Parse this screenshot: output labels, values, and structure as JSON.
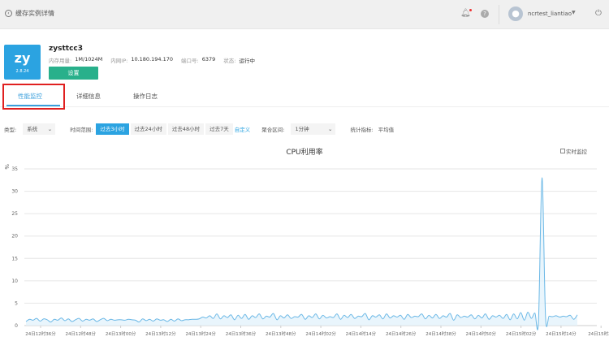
{
  "header": {
    "back_label": "缓存实例详情",
    "username": "ncrtest_liantiao",
    "icons": [
      "back-circle-icon",
      "bell-icon",
      "help-icon",
      "avatar-icon",
      "caret-down-icon",
      "power-icon"
    ]
  },
  "instance": {
    "logo_text": "zy",
    "version": "2.8.24",
    "name": "zysttcc3",
    "memory_label": "内存用量:",
    "memory_value": "1M/1024M",
    "ip_label": "内网IP:",
    "ip_value": "10.180.194.170",
    "port_label": "端口号:",
    "port_value": "6379",
    "status_label": "状态:",
    "status_value": "运行中",
    "settings_button": "设置"
  },
  "tabs": [
    {
      "label": "性能监控",
      "active": true
    },
    {
      "label": "详细信息"
    },
    {
      "label": "操作日志"
    }
  ],
  "filters": {
    "type_label": "类型:",
    "type_value": "系统",
    "range_label": "时间范围:",
    "ranges": [
      "过去3小时",
      "过去24小时",
      "过去48小时",
      "过去7天"
    ],
    "active_range": "过去3小时",
    "custom_link": "自定义",
    "agg_label": "聚合区间:",
    "agg_value": "1分钟",
    "stat_label": "统计指标:",
    "stat_value": "平均值"
  },
  "realtime_label": "实时监控",
  "colors": {
    "accent": "#2ba3e1",
    "button": "#28b08b",
    "line": "#6bb8e6",
    "highlight": "#e02020"
  },
  "chart_data": {
    "type": "area",
    "title": "CPU利用率",
    "ylabel": "%",
    "ylim": [
      0,
      35
    ],
    "yticks": [
      0,
      5,
      10,
      15,
      20,
      25,
      30,
      35
    ],
    "grid": true,
    "xticks": [
      "24日12时36分",
      "24日12时48分",
      "24日13时00分",
      "24日13时12分",
      "24日13时24分",
      "24日13时36分",
      "24日13时48分",
      "24日14时02分",
      "24日14时14分",
      "24日14时26分",
      "24日14时38分",
      "24日14时50分",
      "24日15时02分",
      "24日15时14分",
      "24日15时26"
    ],
    "values": [
      0.9,
      1.4,
      1.2,
      1.6,
      1.0,
      1.5,
      1.3,
      0.8,
      1.4,
      1.2,
      1.7,
      1.1,
      1.5,
      0.9,
      1.3,
      1.6,
      1.0,
      1.4,
      1.2,
      1.5,
      0.9,
      1.3,
      1.6,
      1.1,
      1.4,
      1.2,
      1.3,
      1.3,
      1.2,
      1.4,
      1.3,
      1.2,
      0.8,
      1.5,
      1.1,
      1.4,
      1.0,
      1.5,
      1.2,
      1.3,
      0.9,
      1.4,
      1.0,
      1.5,
      1.1,
      1.3,
      1.3,
      1.4,
      1.4,
      1.5,
      1.9,
      1.7,
      2.2,
      1.6,
      2.6,
      1.5,
      2.2,
      1.8,
      2.4,
      1.3,
      2.3,
      1.6,
      2.5,
      1.4,
      2.2,
      1.8,
      2.6,
      1.5,
      2.1,
      1.9,
      2.7,
      1.3,
      2.2,
      1.7,
      2.4,
      1.6,
      2.0,
      1.9,
      2.5,
      1.4,
      2.2,
      1.8,
      2.6,
      1.5,
      2.3,
      1.7,
      2.0,
      1.8,
      2.6,
      1.4,
      2.3,
      1.8,
      2.5,
      1.6,
      2.1,
      2.0,
      2.7,
      1.3,
      2.2,
      1.9,
      2.4,
      1.5,
      2.6,
      1.7,
      2.2,
      1.9,
      2.3,
      1.4,
      2.5,
      1.8,
      2.1,
      2.0,
      2.6,
      1.5,
      2.3,
      1.7,
      2.5,
      1.6,
      2.2,
      1.9,
      2.7,
      1.2,
      2.4,
      1.8,
      2.1,
      1.9,
      2.4,
      1.5,
      2.3,
      1.7,
      2.6,
      1.4,
      2.2,
      1.9,
      2.3,
      1.6,
      2.5,
      1.3,
      2.6,
      1.5,
      2.9,
      1.2,
      3.0,
      1.6,
      2.8,
      0.9,
      33.0,
      2.0,
      2.1,
      2.0,
      2.2,
      1.9,
      2.1,
      2.0,
      2.3,
      1.4,
      2.4
    ]
  }
}
